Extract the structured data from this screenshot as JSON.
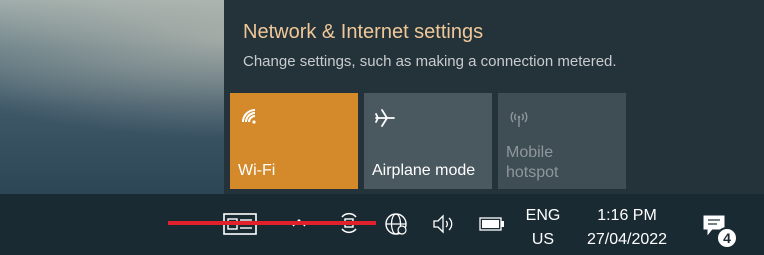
{
  "flyout": {
    "title": "Network & Internet settings",
    "subtitle": "Change settings, such as making a connection metered.",
    "tiles": [
      {
        "label": "Wi-Fi",
        "icon": "wifi-icon",
        "state": "active",
        "color": "#d48a2b"
      },
      {
        "label": "Airplane mode",
        "icon": "airplane-icon",
        "state": "inactive",
        "color": "#4a585f"
      },
      {
        "label_line1": "Mobile",
        "label_line2": "hotspot",
        "icon": "hotspot-icon",
        "state": "disabled",
        "color": "#3f4d54"
      }
    ]
  },
  "taskbar": {
    "language_line1": "ENG",
    "language_line2": "US",
    "time": "1:16 PM",
    "date": "27/04/2022",
    "notification_count": "4",
    "icons": [
      "news-widget-icon",
      "chevron-up-icon",
      "meet-now-icon",
      "globe-network-icon",
      "speaker-icon",
      "battery-icon",
      "action-center-icon"
    ],
    "annotation_arrow_color": "#e0202a"
  }
}
